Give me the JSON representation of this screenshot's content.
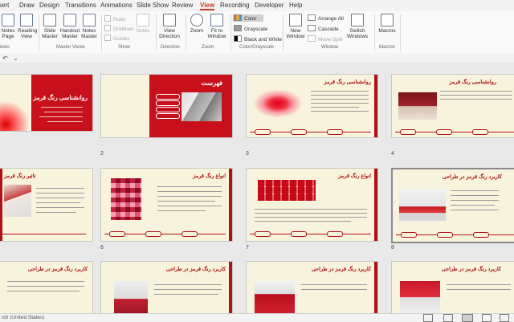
{
  "tabs": [
    "sert",
    "Draw",
    "Design",
    "Transitions",
    "Animations",
    "Slide Show",
    "Review",
    "View",
    "Recording",
    "Developer",
    "Help"
  ],
  "active_tab": "View",
  "ribbon": {
    "presentation_views": {
      "normal": "Notes\nPage",
      "reading": "Reading\nView",
      "partial_label": "iews"
    },
    "master_views": {
      "slide": "Slide\nMaster",
      "handout": "Handout\nMaster",
      "notes": "Notes\nMaster",
      "label": "Master Views"
    },
    "show": {
      "ruler": "Ruler",
      "gridlines": "Gridlines",
      "guides": "Guides",
      "notes": "Notes",
      "label": "Show"
    },
    "direction": {
      "button": "View\nDirection",
      "label": "Direction"
    },
    "zoom": {
      "zoom": "Zoom",
      "fit": "Fit to\nWindow",
      "label": "Zoom"
    },
    "color": {
      "color": "Color",
      "grayscale": "Grayscale",
      "bw": "Black and White",
      "label": "Color/Grayscale"
    },
    "window": {
      "new": "New\nWindow",
      "arrange": "Arrange All",
      "cascade": "Cascade",
      "move": "Move Split",
      "switch": "Switch\nWindows",
      "label": "Window"
    },
    "macros": {
      "button": "Macros",
      "label": "Macros"
    }
  },
  "slides": [
    {
      "num": "",
      "title": "روانشناسی رنگ قرمز",
      "kind": "cover"
    },
    {
      "num": "2",
      "title": "فهرست",
      "kind": "toc"
    },
    {
      "num": "3",
      "title": "روانشناسی رنگ قرمز",
      "kind": "splash"
    },
    {
      "num": "4",
      "title": "روانشناسی رنگ قرمز",
      "kind": "room"
    },
    {
      "num": "",
      "title": "تاثیر رنگ قرمز",
      "kind": "left-pic"
    },
    {
      "num": "6",
      "title": "انواع رنگ قرمز",
      "kind": "swatch"
    },
    {
      "num": "7",
      "title": "انواع رنگ قرمز",
      "kind": "palette"
    },
    {
      "num": "8",
      "title": "کاربرد رنگ قرمز در طراحی",
      "kind": "room2"
    },
    {
      "num": "",
      "title": "کاربرد رنگ قرمز در طراحی",
      "kind": "partial"
    },
    {
      "num": "",
      "title": "کاربرد رنگ قرمز در طراحی",
      "kind": "partial"
    },
    {
      "num": "",
      "title": "کاربرد رنگ قرمز در طراحی",
      "kind": "partial"
    },
    {
      "num": "",
      "title": "کاربرد رنگ قرمز در طراحی",
      "kind": "partial"
    }
  ],
  "status": {
    "language": "ish (United States)"
  },
  "colors": {
    "accent": "#c43e1c",
    "slide_red": "#b01018",
    "slide_bg": "#f8f3dc"
  }
}
